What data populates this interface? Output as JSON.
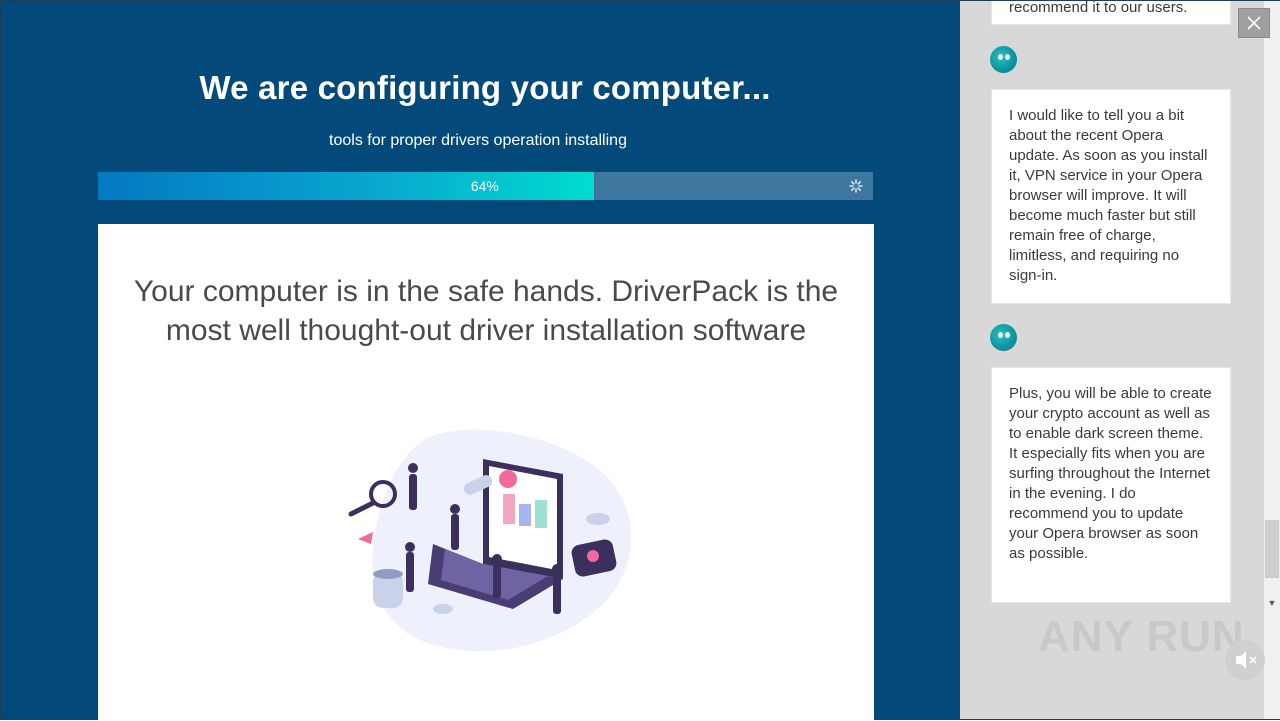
{
  "installer": {
    "title": "We are configuring your computer...",
    "subtitle": "tools for proper drivers operation installing",
    "progress_percent": 64,
    "progress_label": "64%",
    "card_text": "Your computer is in the safe hands. DriverPack is the most well thought-out driver installation software"
  },
  "chat": {
    "top_fragment": "recommend it to our users.",
    "messages": [
      "I would like to tell you a bit about the recent Opera update. As soon as you install it, VPN service in your Opera browser will improve. It will become much faster but still remain free of charge, limitless, and requiring no sign-in.",
      "Plus, you will be able to create your crypto account as well as to enable dark screen theme. It especially fits when you are surfing throughout the Internet in the evening. I do recommend you to update your Opera browser as soon as possible."
    ]
  },
  "watermark": "ANY RUN",
  "colors": {
    "left_bg": "#03497a",
    "progress_start": "#0479c2",
    "progress_end": "#00dccf",
    "right_bg": "#d8d8d8",
    "avatar": "#17a9b4"
  },
  "icons": {
    "close": "close-icon",
    "spinner": "spinner-icon",
    "avatar": "bot-avatar-icon",
    "mute": "speaker-mute-icon"
  }
}
